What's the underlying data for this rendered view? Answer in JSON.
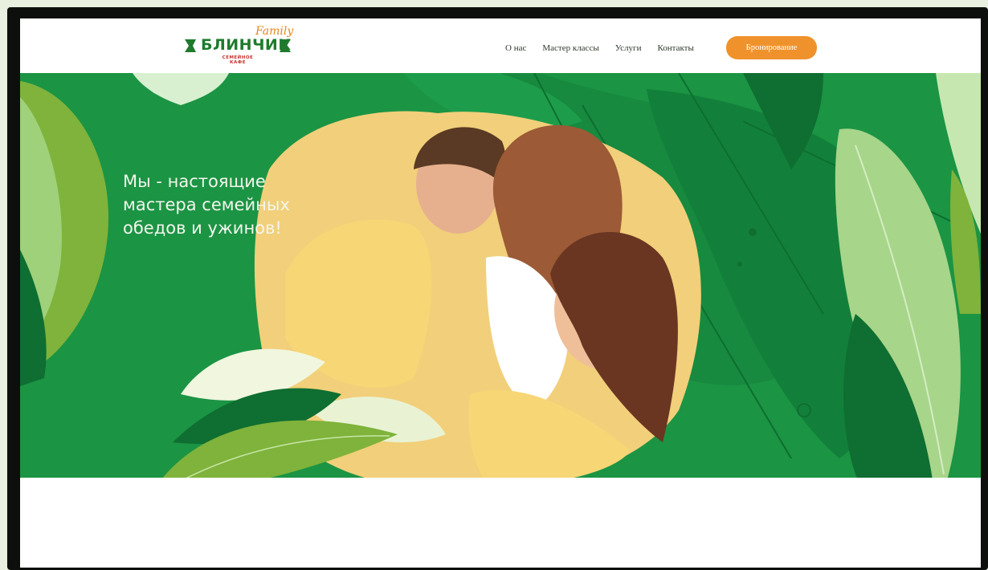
{
  "logo": {
    "script": "Family",
    "wordmark": "БЛИНЧИК",
    "tagline": "СЕМЕЙНОЕ КАФЕ"
  },
  "nav": {
    "items": [
      {
        "label": "О нас"
      },
      {
        "label": "Мастер классы"
      },
      {
        "label": "Услуги"
      },
      {
        "label": "Контакты"
      }
    ],
    "cta_label": "Бронирование"
  },
  "hero": {
    "headline_lines": [
      "Мы - настоящие",
      "мастера семейных",
      "обедов и ужинов!"
    ]
  },
  "colors": {
    "hero_green": "#1b9444",
    "accent_orange": "#f0922c",
    "logo_green": "#1f7a2e",
    "logo_red": "#c6322c",
    "light_leaf": "#a7d58a",
    "dark_leaf": "#0f6e31"
  }
}
